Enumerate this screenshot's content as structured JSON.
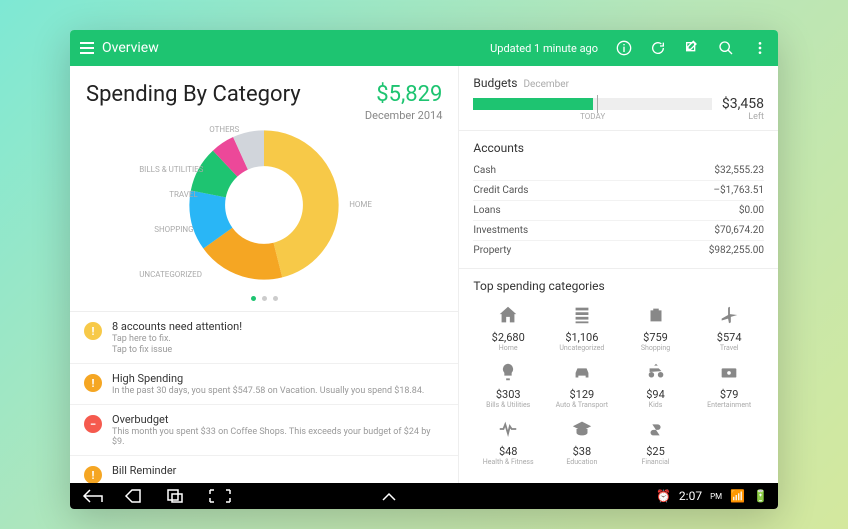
{
  "header": {
    "title": "Overview",
    "updated": "Updated 1 minute ago"
  },
  "spending": {
    "title": "Spending By Category",
    "amount": "$5,829",
    "date": "December 2014"
  },
  "chart_data": {
    "type": "pie",
    "title": "Spending By Category",
    "categories": [
      "HOME",
      "UNCATEGORIZED",
      "SHOPPING",
      "TRAVEL",
      "BILLS & UTILITIES",
      "OTHERS"
    ],
    "values": [
      2680,
      1106,
      759,
      574,
      303,
      407
    ],
    "colors": [
      "#f7c948",
      "#f5a623",
      "#29b6f6",
      "#1ec471",
      "#ec4899",
      "#d1d5db"
    ]
  },
  "alerts": [
    {
      "title": "8 accounts need attention!",
      "sub1": "Tap here to fix.",
      "sub2": "Tap to fix issue",
      "color": "yellow"
    },
    {
      "title": "High Spending",
      "sub1": "In the past 30 days, you spent $547.58 on Vacation.  Usually you spend $18.84.",
      "color": "orange"
    },
    {
      "title": "Overbudget",
      "sub1": "This month you spent $33 on Coffee Shops. This exceeds your budget of $24 by $9.",
      "color": "red"
    },
    {
      "title": "Bill Reminder",
      "sub1": "",
      "color": "orange"
    }
  ],
  "budgets": {
    "head": "Budgets",
    "sub": "December",
    "amount": "$3,458",
    "left": "Left",
    "today": "TODAY"
  },
  "accounts": {
    "head": "Accounts",
    "rows": [
      {
        "name": "Cash",
        "value": "$32,555.23"
      },
      {
        "name": "Credit Cards",
        "value": "–$1,763.51"
      },
      {
        "name": "Loans",
        "value": "$0.00"
      },
      {
        "name": "Investments",
        "value": "$70,674.20"
      },
      {
        "name": "Property",
        "value": "$982,255.00"
      }
    ]
  },
  "topcats": {
    "head": "Top spending categories",
    "items": [
      {
        "icon": "home",
        "amount": "$2,680",
        "name": "Home"
      },
      {
        "icon": "uncat",
        "amount": "$1,106",
        "name": "Uncategorized"
      },
      {
        "icon": "shopping",
        "amount": "$759",
        "name": "Shopping"
      },
      {
        "icon": "travel",
        "amount": "$574",
        "name": "Travel"
      },
      {
        "icon": "bulb",
        "amount": "$303",
        "name": "Bills & Utilities"
      },
      {
        "icon": "car",
        "amount": "$129",
        "name": "Auto & Transport"
      },
      {
        "icon": "kids",
        "amount": "$94",
        "name": "Kids"
      },
      {
        "icon": "ent",
        "amount": "$79",
        "name": "Entertainment"
      },
      {
        "icon": "health",
        "amount": "$48",
        "name": "Health & Fitness"
      },
      {
        "icon": "edu",
        "amount": "$38",
        "name": "Education"
      },
      {
        "icon": "fin",
        "amount": "$25",
        "name": "Financial"
      }
    ]
  },
  "navbar": {
    "time": "2:07"
  }
}
